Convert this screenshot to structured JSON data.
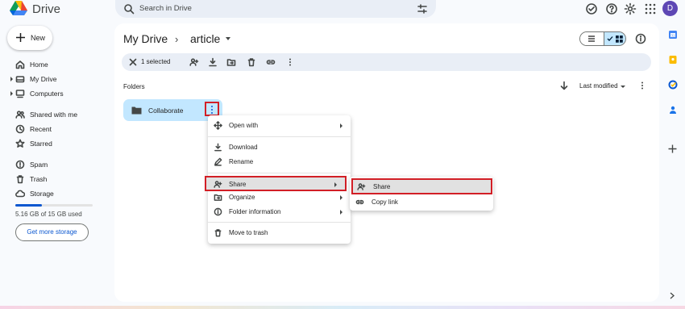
{
  "app": {
    "title": "Drive",
    "avatar_initial": "D"
  },
  "search": {
    "placeholder": "Search in Drive"
  },
  "sidebar": {
    "new_label": "New",
    "items": [
      {
        "label": "Home",
        "icon": "home-icon"
      },
      {
        "label": "My Drive",
        "icon": "drive-icon"
      },
      {
        "label": "Computers",
        "icon": "computer-icon"
      },
      {
        "label": "Shared with me",
        "icon": "people-icon"
      },
      {
        "label": "Recent",
        "icon": "clock-icon"
      },
      {
        "label": "Starred",
        "icon": "star-icon"
      },
      {
        "label": "Spam",
        "icon": "spam-icon"
      },
      {
        "label": "Trash",
        "icon": "trash-icon"
      },
      {
        "label": "Storage",
        "icon": "cloud-icon"
      }
    ],
    "storage_text": "5.16 GB of 15 GB used",
    "storage_fraction": 0.344,
    "get_storage_label": "Get more storage"
  },
  "breadcrumb": {
    "root": "My Drive",
    "separator": "›",
    "current": "article"
  },
  "selection_bar": {
    "count_label": "1 selected"
  },
  "folders": {
    "heading": "Folders",
    "sort_label": "Last modified",
    "items": [
      {
        "name": "Collaborate"
      }
    ]
  },
  "context_menu": {
    "items": [
      {
        "label": "Open with",
        "icon": "move-icon",
        "submenu": true
      },
      {
        "label": "Download",
        "icon": "download-icon",
        "submenu": false
      },
      {
        "label": "Rename",
        "icon": "rename-icon",
        "submenu": false
      },
      {
        "label": "Share",
        "icon": "share-person-icon",
        "submenu": true
      },
      {
        "label": "Organize",
        "icon": "folder-move-icon",
        "submenu": true
      },
      {
        "label": "Folder information",
        "icon": "info-icon",
        "submenu": true
      },
      {
        "label": "Move to trash",
        "icon": "trash-icon",
        "submenu": false
      }
    ]
  },
  "share_submenu": {
    "items": [
      {
        "label": "Share",
        "icon": "share-person-icon"
      },
      {
        "label": "Copy link",
        "icon": "link-icon"
      }
    ]
  },
  "colors": {
    "accent": "#0b57d0",
    "selected_bg": "#c2e7ff",
    "highlight_border": "#d21f26"
  }
}
